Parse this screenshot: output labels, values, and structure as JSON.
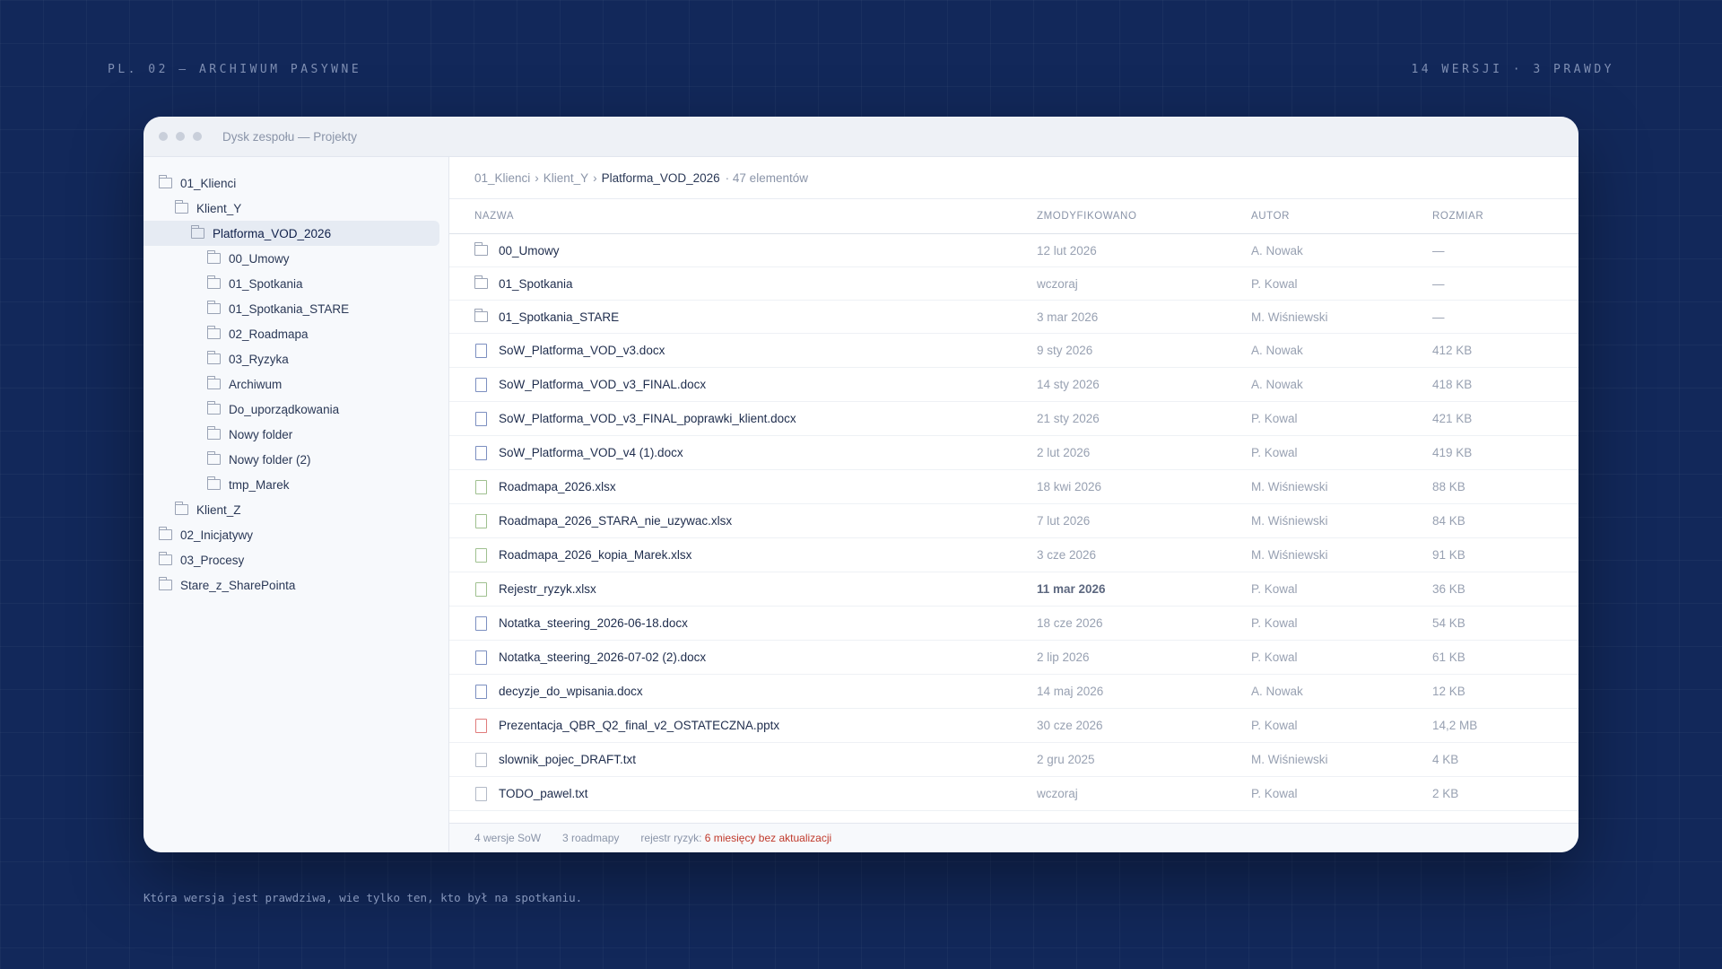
{
  "captions": {
    "top_left": "PL. 02 — ARCHIWUM PASYWNE",
    "top_right": "14 WERSJI · 3 PRAWDY",
    "bottom": "Która wersja jest prawdziwa, wie tylko ten, kto był na spotkaniu."
  },
  "window": {
    "title": "Dysk zespołu — Projekty"
  },
  "sidebar": {
    "items": [
      {
        "label": "01_Klienci",
        "depth": 0,
        "selected": false
      },
      {
        "label": "Klient_Y",
        "depth": 1,
        "selected": false
      },
      {
        "label": "Platforma_VOD_2026",
        "depth": 2,
        "selected": true
      },
      {
        "label": "00_Umowy",
        "depth": 3,
        "selected": false
      },
      {
        "label": "01_Spotkania",
        "depth": 3,
        "selected": false
      },
      {
        "label": "01_Spotkania_STARE",
        "depth": 3,
        "selected": false
      },
      {
        "label": "02_Roadmapa",
        "depth": 3,
        "selected": false
      },
      {
        "label": "03_Ryzyka",
        "depth": 3,
        "selected": false
      },
      {
        "label": "Archiwum",
        "depth": 3,
        "selected": false
      },
      {
        "label": "Do_uporządkowania",
        "depth": 3,
        "selected": false
      },
      {
        "label": "Nowy folder",
        "depth": 3,
        "selected": false
      },
      {
        "label": "Nowy folder (2)",
        "depth": 3,
        "selected": false
      },
      {
        "label": "tmp_Marek",
        "depth": 3,
        "selected": false
      },
      {
        "label": "Klient_Z",
        "depth": 1,
        "selected": false
      },
      {
        "label": "02_Inicjatywy",
        "depth": 0,
        "selected": false
      },
      {
        "label": "03_Procesy",
        "depth": 0,
        "selected": false
      },
      {
        "label": "Stare_z_SharePointa",
        "depth": 0,
        "selected": false
      }
    ]
  },
  "breadcrumb": {
    "parts": [
      "01_Klienci",
      "Klient_Y"
    ],
    "current": "Platforma_VOD_2026",
    "separator": "›",
    "count": "· 47 elementów"
  },
  "table": {
    "headers": {
      "name": "NAZWA",
      "modified": "ZMODYFIKOWANO",
      "author": "AUTOR",
      "size": "ROZMIAR"
    },
    "rows": [
      {
        "kind": "folder",
        "name": "00_Umowy",
        "modified": "12 lut 2026",
        "author": "A. Nowak",
        "size": "—"
      },
      {
        "kind": "folder",
        "name": "01_Spotkania",
        "modified": "wczoraj",
        "author": "P. Kowal",
        "size": "—"
      },
      {
        "kind": "folder",
        "name": "01_Spotkania_STARE",
        "modified": "3 mar 2026",
        "author": "M. Wiśniewski",
        "size": "—"
      },
      {
        "kind": "file",
        "icon_color": "#7c8fc0",
        "name": "SoW_Platforma_VOD_v3.docx",
        "modified": "9 sty 2026",
        "author": "A. Nowak",
        "size": "412 KB"
      },
      {
        "kind": "file",
        "icon_color": "#7c8fc0",
        "name": "SoW_Platforma_VOD_v3_FINAL.docx",
        "modified": "14 sty 2026",
        "author": "A. Nowak",
        "size": "418 KB"
      },
      {
        "kind": "file",
        "icon_color": "#7c8fc0",
        "name": "SoW_Platforma_VOD_v3_FINAL_poprawki_klient.docx",
        "modified": "21 sty 2026",
        "author": "P. Kowal",
        "size": "421 KB"
      },
      {
        "kind": "file",
        "icon_color": "#7c8fc0",
        "name": "SoW_Platforma_VOD_v4 (1).docx",
        "modified": "2 lut 2026",
        "author": "P. Kowal",
        "size": "419 KB"
      },
      {
        "kind": "file",
        "icon_color": "#9fc08f",
        "name": "Roadmapa_2026.xlsx",
        "modified": "18 kwi 2026",
        "author": "M. Wiśniewski",
        "size": "88 KB"
      },
      {
        "kind": "file",
        "icon_color": "#9fc08f",
        "name": "Roadmapa_2026_STARA_nie_uzywac.xlsx",
        "modified": "7 lut 2026",
        "author": "M. Wiśniewski",
        "size": "84 KB"
      },
      {
        "kind": "file",
        "icon_color": "#9fc08f",
        "name": "Roadmapa_2026_kopia_Marek.xlsx",
        "modified": "3 cze 2026",
        "author": "M. Wiśniewski",
        "size": "91 KB"
      },
      {
        "kind": "file",
        "icon_color": "#9fc08f",
        "name": "Rejestr_ryzyk.xlsx",
        "modified": "11 mar 2026",
        "modified_bold": true,
        "author": "P. Kowal",
        "size": "36 KB"
      },
      {
        "kind": "file",
        "icon_color": "#7c8fc0",
        "name": "Notatka_steering_2026-06-18.docx",
        "modified": "18 cze 2026",
        "author": "P. Kowal",
        "size": "54 KB"
      },
      {
        "kind": "file",
        "icon_color": "#7c8fc0",
        "name": "Notatka_steering_2026-07-02 (2).docx",
        "modified": "2 lip 2026",
        "author": "P. Kowal",
        "size": "61 KB"
      },
      {
        "kind": "file",
        "icon_color": "#7c8fc0",
        "name": "decyzje_do_wpisania.docx",
        "modified": "14 maj 2026",
        "author": "A. Nowak",
        "size": "12 KB"
      },
      {
        "kind": "file",
        "icon_color": "#e07b7b",
        "name": "Prezentacja_QBR_Q2_final_v2_OSTATECZNA.pptx",
        "modified": "30 cze 2026",
        "author": "P. Kowal",
        "size": "14,2 MB"
      },
      {
        "kind": "file",
        "icon_color": "#b3bac7",
        "name": "slownik_pojec_DRAFT.txt",
        "modified": "2 gru 2025",
        "author": "M. Wiśniewski",
        "size": "4 KB"
      },
      {
        "kind": "file",
        "icon_color": "#b3bac7",
        "name": "TODO_pawel.txt",
        "modified": "wczoraj",
        "author": "P. Kowal",
        "size": "2 KB"
      }
    ]
  },
  "footer": {
    "versions": "4 wersje SoW",
    "roadmaps": "3 roadmapy",
    "risk_label": "rejestr ryzyk:",
    "risk_alert": "6 miesięcy bez aktualizacji",
    "alert_color": "#c0392b"
  }
}
